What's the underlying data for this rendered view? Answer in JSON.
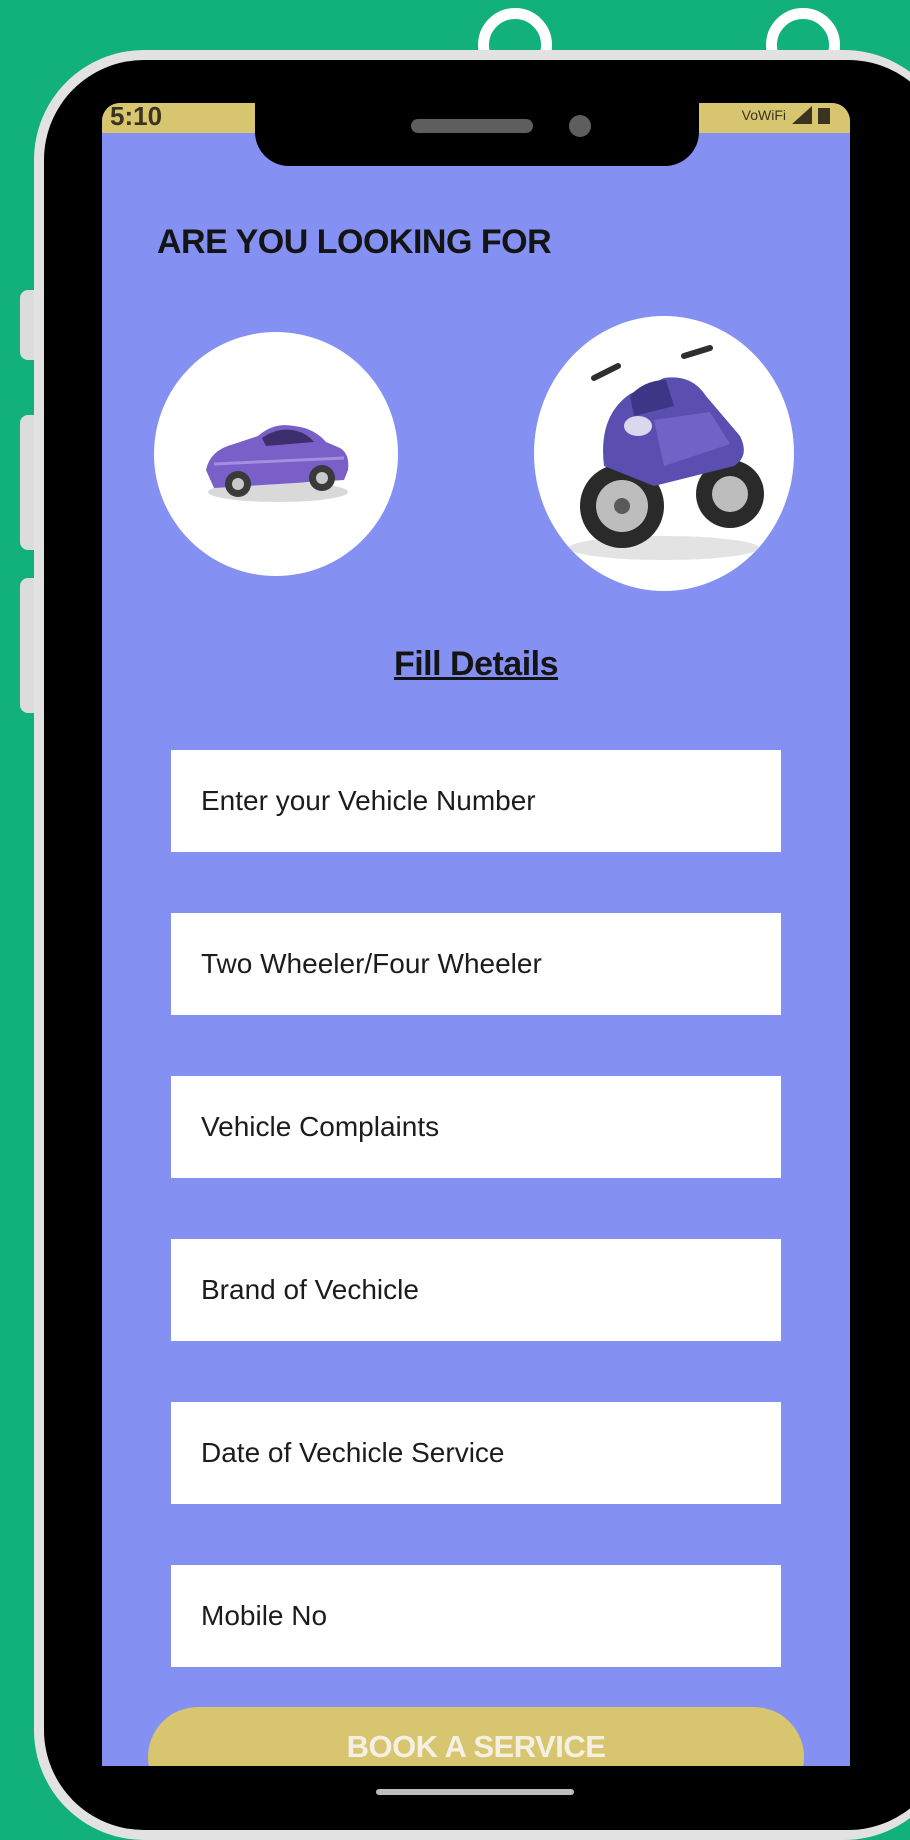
{
  "status_bar": {
    "time": "5:10",
    "network": "VoWiFi"
  },
  "header": {
    "title": "ARE YOU LOOKING FOR"
  },
  "vehicle_options": [
    {
      "name": "car",
      "icon": "car-icon"
    },
    {
      "name": "motorcycle",
      "icon": "motorcycle-icon"
    }
  ],
  "form": {
    "heading": "Fill Details",
    "fields": {
      "vehicle_number": {
        "placeholder": "Enter your Vehicle Number"
      },
      "vehicle_type": {
        "placeholder": "Two Wheeler/Four Wheeler"
      },
      "complaints": {
        "placeholder": "Vehicle Complaints"
      },
      "brand": {
        "placeholder": "Brand of Vechicle"
      },
      "service_date": {
        "placeholder": "Date of Vechicle Service"
      },
      "mobile": {
        "placeholder": "Mobile No"
      }
    },
    "submit_label": "BOOK A SERVICE"
  },
  "colors": {
    "background": "#12b07a",
    "screen": "#8591f2",
    "accent": "#d7c56f",
    "vehicle": "#7a5fc9"
  }
}
